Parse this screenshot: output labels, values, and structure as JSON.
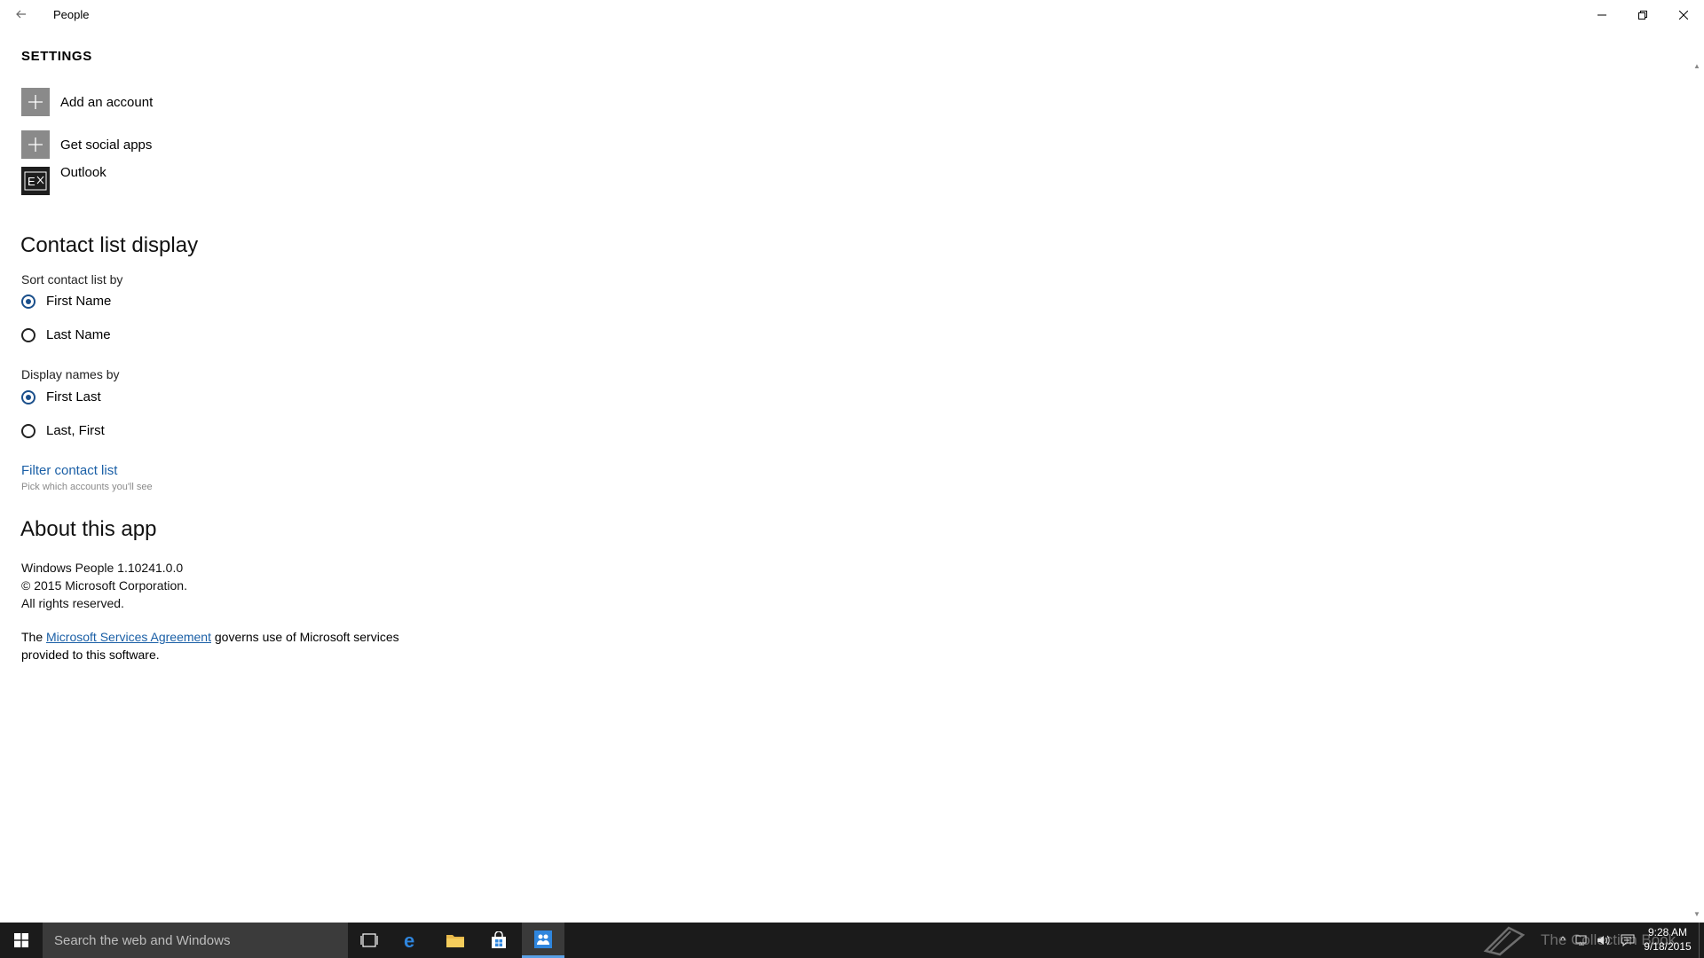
{
  "window": {
    "title": "People",
    "controls": {
      "minimize": "minimize",
      "maximize": "restore",
      "close": "close"
    }
  },
  "settings": {
    "heading": "SETTINGS",
    "accounts": [
      {
        "label": "Add an account",
        "icon": "plus-icon"
      },
      {
        "label": "Get social apps",
        "icon": "plus-icon"
      },
      {
        "label": "Outlook",
        "icon": "exchange-icon"
      }
    ]
  },
  "contact_display": {
    "title": "Contact list display",
    "sort_label": "Sort contact list by",
    "sort_options": [
      {
        "label": "First Name",
        "checked": true
      },
      {
        "label": "Last Name",
        "checked": false
      }
    ],
    "display_label": "Display names by",
    "display_options": [
      {
        "label": "First Last",
        "checked": true
      },
      {
        "label": "Last, First",
        "checked": false
      }
    ],
    "filter_link": "Filter contact list",
    "filter_hint": "Pick which accounts you'll see"
  },
  "about": {
    "title": "About this app",
    "version": "Windows People 1.10241.0.0",
    "copyright": "© 2015 Microsoft Corporation.",
    "rights": "All rights reserved.",
    "agreement_prefix": "The ",
    "agreement_link": "Microsoft Services Agreement",
    "agreement_suffix": " governs use of Microsoft services provided to this software."
  },
  "taskbar": {
    "search_placeholder": "Search the web and Windows",
    "watermark": "The Collection Book",
    "time": "9:28 AM",
    "date": "9/18/2015"
  },
  "colors": {
    "accent": "#1a5fa6",
    "taskbar": "#1b1b1b",
    "search_box": "#3b3b3b",
    "tile": "#8a8a8a"
  }
}
